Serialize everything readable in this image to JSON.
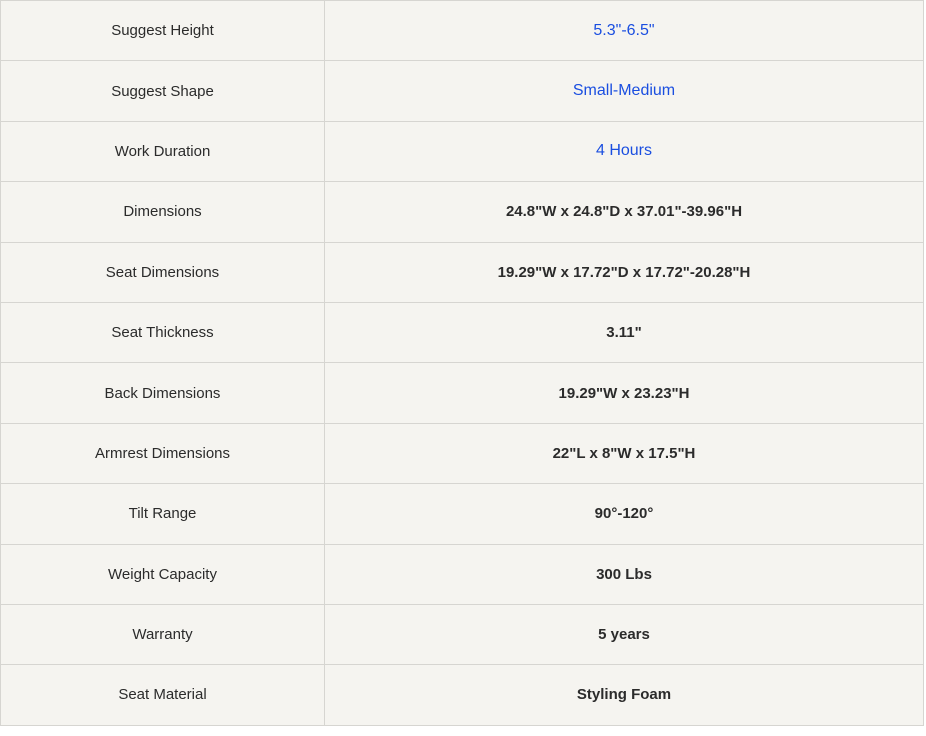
{
  "colors": {
    "accent_value": "#1a4ee0",
    "text": "#2b2b2b",
    "background": "#f5f4f0",
    "border": "#d6d5d1"
  },
  "specs": [
    {
      "label": "Suggest Height",
      "value": "5.3\"-6.5\"",
      "accent": true
    },
    {
      "label": "Suggest Shape",
      "value": "Small-Medium",
      "accent": true
    },
    {
      "label": "Work Duration",
      "value": "4 Hours",
      "accent": true
    },
    {
      "label": "Dimensions",
      "value": "24.8\"W x 24.8\"D x 37.01\"-39.96\"H",
      "accent": false
    },
    {
      "label": "Seat Dimensions",
      "value": "19.29\"W x 17.72\"D x 17.72\"-20.28\"H",
      "accent": false
    },
    {
      "label": "Seat Thickness",
      "value": "3.11\"",
      "accent": false
    },
    {
      "label": "Back Dimensions",
      "value": "19.29\"W x 23.23\"H",
      "accent": false
    },
    {
      "label": "Armrest Dimensions",
      "value": "22\"L x 8\"W x 17.5\"H",
      "accent": false
    },
    {
      "label": "Tilt Range",
      "value": "90°-120°",
      "accent": false
    },
    {
      "label": "Weight Capacity",
      "value": "300 Lbs",
      "accent": false
    },
    {
      "label": "Warranty",
      "value": "5 years",
      "accent": false
    },
    {
      "label": "Seat Material",
      "value": "Styling Foam",
      "accent": false
    }
  ]
}
